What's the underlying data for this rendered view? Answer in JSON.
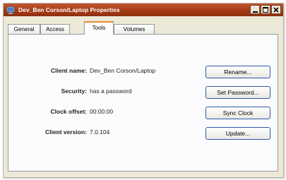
{
  "window": {
    "title": "Dev_Ben Corson/Laptop Properties",
    "title_color": "#a33a16"
  },
  "tabs": [
    {
      "label": "General",
      "active": false
    },
    {
      "label": "Access",
      "active": false
    },
    {
      "label": "Tools",
      "active": true
    },
    {
      "label": "Volumes",
      "active": false
    }
  ],
  "rows": [
    {
      "label": "Client name:",
      "value": "Dev_Ben Corson/Laptop",
      "button": "Rename..."
    },
    {
      "label": "Security:",
      "value": "has a password",
      "button": "Set Password..."
    },
    {
      "label": "Clock offset:",
      "value": "00:00:00",
      "button": "Sync Clock"
    },
    {
      "label": "Client version:",
      "value": "7.0.104",
      "button": "Update..."
    }
  ],
  "icons": {
    "app": "computer-icon",
    "minimize": "minimize-icon",
    "maximize": "maximize-icon",
    "close": "close-icon"
  }
}
